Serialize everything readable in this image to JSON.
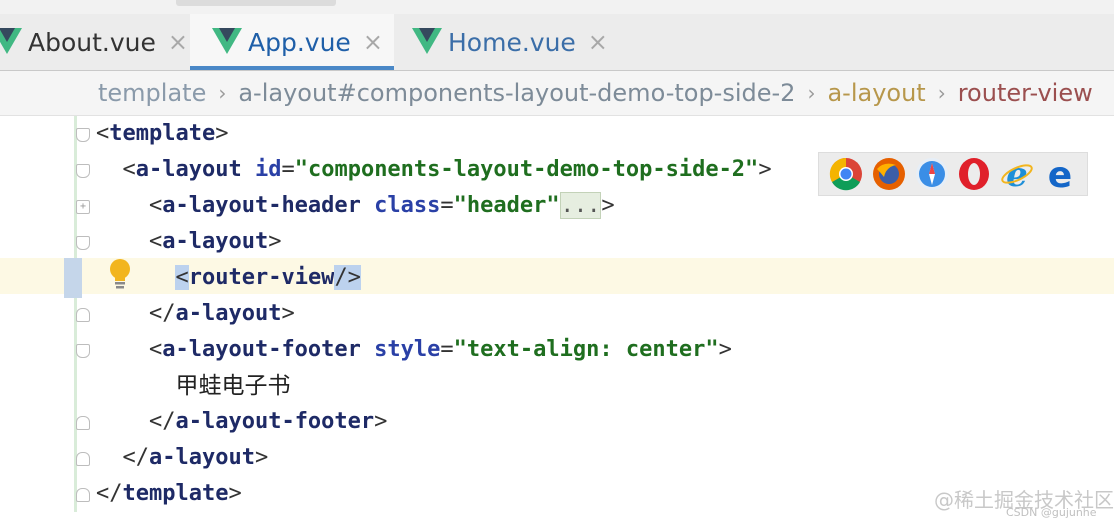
{
  "tabs": [
    {
      "label": "About.vue",
      "icon": "vue-icon",
      "active": false
    },
    {
      "label": "App.vue",
      "icon": "vue-icon",
      "active": true
    },
    {
      "label": "Home.vue",
      "icon": "vue-icon",
      "active": false
    }
  ],
  "close_glyph": "×",
  "breadcrumb": {
    "items": [
      "template",
      "a-layout#components-layout-demo-top-side-2",
      "a-layout",
      "router-view"
    ],
    "separator": "›"
  },
  "code": {
    "lines": [
      {
        "indent": "",
        "tokens": [
          {
            "t": "pn",
            "v": "<"
          },
          {
            "t": "tag",
            "v": "template"
          },
          {
            "t": "pn",
            "v": ">"
          }
        ]
      },
      {
        "indent": "  ",
        "tokens": [
          {
            "t": "pn",
            "v": "<"
          },
          {
            "t": "tag",
            "v": "a-layout"
          },
          {
            "t": "pn",
            "v": " "
          },
          {
            "t": "attr",
            "v": "id"
          },
          {
            "t": "pn",
            "v": "="
          },
          {
            "t": "str",
            "v": "\"components-layout-demo-top-side-2\""
          },
          {
            "t": "pn",
            "v": ">"
          }
        ]
      },
      {
        "indent": "    ",
        "tokens": [
          {
            "t": "pn",
            "v": "<"
          },
          {
            "t": "tag",
            "v": "a-layout-header"
          },
          {
            "t": "pn",
            "v": " "
          },
          {
            "t": "attr",
            "v": "class"
          },
          {
            "t": "pn",
            "v": "="
          },
          {
            "t": "str",
            "v": "\"header\""
          },
          {
            "t": "fold",
            "v": "..."
          },
          {
            "t": "pn",
            "v": ">"
          }
        ]
      },
      {
        "indent": "    ",
        "tokens": [
          {
            "t": "pn",
            "v": "<"
          },
          {
            "t": "tag",
            "v": "a-layout"
          },
          {
            "t": "pn",
            "v": ">"
          }
        ]
      },
      {
        "indent": "      ",
        "tokens": [
          {
            "t": "selpn",
            "v": "<"
          },
          {
            "t": "tag",
            "v": "router-view"
          },
          {
            "t": "selpn",
            "v": "/>"
          }
        ]
      },
      {
        "indent": "    ",
        "tokens": [
          {
            "t": "pn",
            "v": "</"
          },
          {
            "t": "tag",
            "v": "a-layout"
          },
          {
            "t": "pn",
            "v": ">"
          }
        ]
      },
      {
        "indent": "    ",
        "tokens": [
          {
            "t": "pn",
            "v": "<"
          },
          {
            "t": "tag",
            "v": "a-layout-footer"
          },
          {
            "t": "pn",
            "v": " "
          },
          {
            "t": "attr",
            "v": "style"
          },
          {
            "t": "pn",
            "v": "="
          },
          {
            "t": "str",
            "v": "\"text-align: center\""
          },
          {
            "t": "pn",
            "v": ">"
          }
        ]
      },
      {
        "indent": "      ",
        "tokens": [
          {
            "t": "txt",
            "v": "甲蛙电子书"
          }
        ]
      },
      {
        "indent": "    ",
        "tokens": [
          {
            "t": "pn",
            "v": "</"
          },
          {
            "t": "tag",
            "v": "a-layout-footer"
          },
          {
            "t": "pn",
            "v": ">"
          }
        ]
      },
      {
        "indent": "  ",
        "tokens": [
          {
            "t": "pn",
            "v": "</"
          },
          {
            "t": "tag",
            "v": "a-layout"
          },
          {
            "t": "pn",
            "v": ">"
          }
        ]
      },
      {
        "indent": "",
        "tokens": [
          {
            "t": "pn",
            "v": "</"
          },
          {
            "t": "tag",
            "v": "template"
          },
          {
            "t": "pn",
            "v": ">"
          }
        ]
      }
    ]
  },
  "browser_icons": [
    "chrome-icon",
    "firefox-icon",
    "safari-icon",
    "opera-icon",
    "ie-icon",
    "edge-icon"
  ],
  "watermark": {
    "main": "@稀土掘金技术社区",
    "sub": "CSDN @gujunhe"
  },
  "colors": {
    "active_tab_underline": "#4a88c7",
    "tag": "#1e2a66",
    "attr": "#2a40a6",
    "string": "#1f6e1f",
    "vue_green": "#41b883",
    "vue_dark": "#35495e"
  }
}
